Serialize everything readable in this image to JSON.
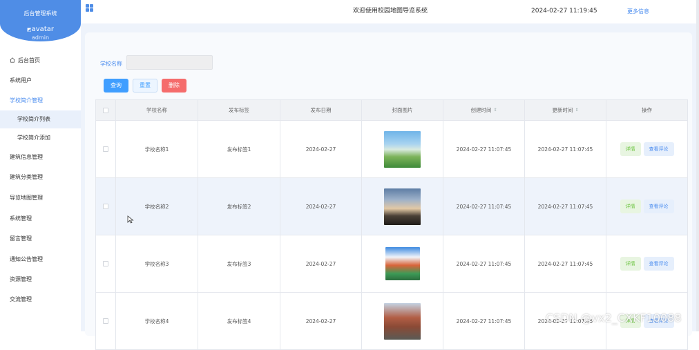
{
  "sidebar": {
    "title": "后台管理系统",
    "avatar_alt": "avatar",
    "user": "admin",
    "items": [
      {
        "label": "后台首页",
        "icon": "home-icon"
      },
      {
        "label": "系统用户"
      },
      {
        "label": "学校简介管理"
      },
      {
        "label": "学校简介列表"
      },
      {
        "label": "学校简介添加"
      },
      {
        "label": "建筑信息管理"
      },
      {
        "label": "建筑分类管理"
      },
      {
        "label": "导览地图管理"
      },
      {
        "label": "系统管理"
      },
      {
        "label": "留言管理"
      },
      {
        "label": "通知公告管理"
      },
      {
        "label": "资源管理"
      },
      {
        "label": "交流管理"
      }
    ]
  },
  "header": {
    "menu_icon": "grid-icon",
    "title": "欢迎使用校园地图导览系统",
    "datetime": "2024-02-27 11:19:45",
    "more": "更多信息"
  },
  "search": {
    "label": "学校名称",
    "value": "",
    "query_btn": "查询",
    "reset_btn": "重置",
    "delete_btn": "删除"
  },
  "table": {
    "columns": [
      "学校名称",
      "发布标签",
      "发布日期",
      "封面图片",
      "创建时间",
      "更新时间",
      "操作"
    ],
    "detail_btn": "详情",
    "comment_btn": "查看评论",
    "rows": [
      {
        "name": "学校名称1",
        "tag": "发布标签1",
        "date": "2024-02-27",
        "created": "2024-02-27 11:07:45",
        "updated": "2024-02-27 11:07:45"
      },
      {
        "name": "学校名称2",
        "tag": "发布标签2",
        "date": "2024-02-27",
        "created": "2024-02-27 11:07:45",
        "updated": "2024-02-27 11:07:45"
      },
      {
        "name": "学校名称3",
        "tag": "发布标签3",
        "date": "2024-02-27",
        "created": "2024-02-27 11:07:45",
        "updated": "2024-02-27 11:07:45"
      },
      {
        "name": "学校名称4",
        "tag": "发布标签4",
        "date": "2024-02-27",
        "created": "2024-02-27 11:07:45",
        "updated": "2024-02-27 11:07:45"
      }
    ]
  },
  "watermark": "CSDN @vx2_CXKF10088",
  "colors": {
    "primary": "#409eff",
    "danger": "#f56c6c",
    "sidebar_header": "#4f8de6"
  }
}
